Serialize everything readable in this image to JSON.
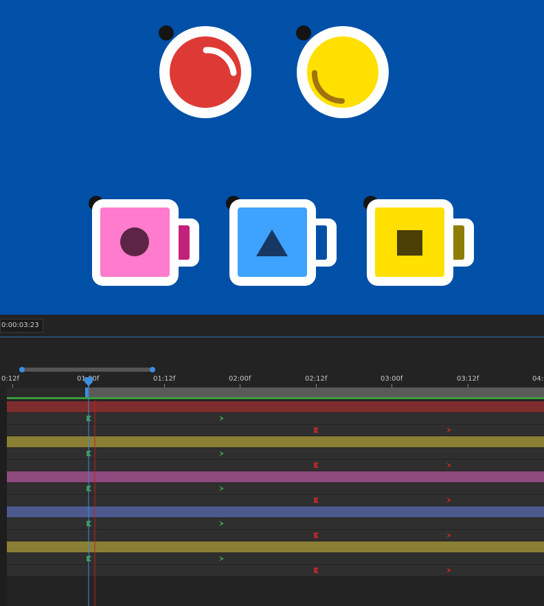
{
  "stage": {
    "background": "#0050a8",
    "elements": [
      {
        "name": "red-button-icon",
        "kind": "circle",
        "fill": "#de3a35"
      },
      {
        "name": "yellow-button-icon",
        "kind": "circle",
        "fill": "#ffe000"
      },
      {
        "name": "pink-mug-circle-icon",
        "kind": "mug",
        "fill": "#ff7bce",
        "handle": "#c2207a",
        "symbol": "circle",
        "symbol_color": "#5c2545"
      },
      {
        "name": "blue-mug-triangle-icon",
        "kind": "mug",
        "fill": "#3ea2ff",
        "handle": "#ffffff",
        "symbol": "triangle",
        "symbol_color": "#173862"
      },
      {
        "name": "yellow-mug-square-icon",
        "kind": "mug",
        "fill": "#ffe000",
        "handle": "#8d7c05",
        "symbol": "square",
        "symbol_color": "#4a3f05"
      }
    ]
  },
  "timeline": {
    "current_time": "0:00:03:23",
    "ruler_labels": [
      "0:12f",
      "01:00f",
      "01:12f",
      "02:00f",
      "02:12f",
      "03:00f",
      "03:12f",
      "04:0"
    ],
    "colors": {
      "playhead": "#3b8fe0",
      "work_area": "#3a9d3a",
      "end_line": "#c02020",
      "keyframe_green": "#3e9a4c",
      "keyframe_red": "#b52a2a"
    },
    "layers": [
      {
        "name": "layer-red",
        "color": "#7d2d2d"
      },
      {
        "name": "layer-yellow",
        "color": "#8a7f34"
      },
      {
        "name": "layer-pink",
        "color": "#8e4a7d"
      },
      {
        "name": "layer-blue",
        "color": "#4e5a8e"
      },
      {
        "name": "layer-olive",
        "color": "#8a7f34"
      }
    ]
  }
}
